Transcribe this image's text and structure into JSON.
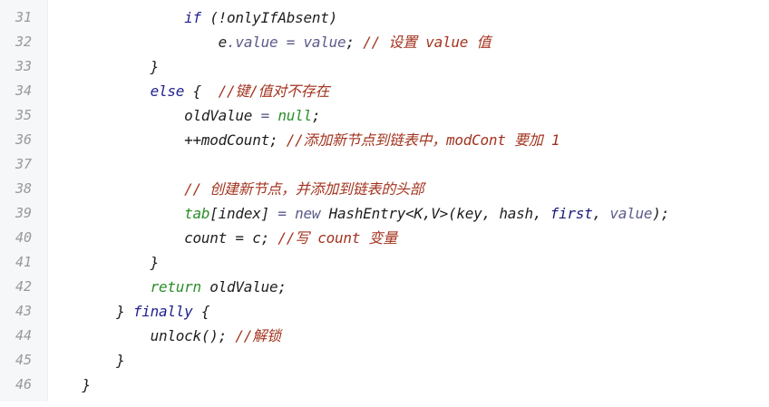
{
  "line_numbers": [
    "31",
    "32",
    "33",
    "34",
    "35",
    "36",
    "37",
    "38",
    "39",
    "40",
    "41",
    "42",
    "43",
    "44",
    "45",
    "46"
  ],
  "lines": {
    "l31": {
      "indent": "                ",
      "kw_if": "if",
      "rest": " (!onlyIfAbsent)"
    },
    "l32": {
      "indent": "                    ",
      "e": "e",
      "dot_value": ".value",
      "eq": " = ",
      "value": "value",
      "semi": "; ",
      "comment": "// 设置 value 值"
    },
    "l33": {
      "indent": "            ",
      "brace": "}"
    },
    "l34": {
      "indent": "            ",
      "kw_else": "else",
      "brace": " {  ",
      "comment": "//键/值对不存在"
    },
    "l35": {
      "indent": "                ",
      "var": "oldValue",
      "eq": " = ",
      "null": "null",
      "semi": ";"
    },
    "l36": {
      "indent": "                ",
      "code": "++modCount; ",
      "comment": "//添加新节点到链表中，modCont 要加 1"
    },
    "l37": {
      "text": ""
    },
    "l38": {
      "indent": "                ",
      "comment": "// 创建新节点，并添加到链表的头部"
    },
    "l39": {
      "indent": "                ",
      "tab": "tab",
      "index": "[index]",
      "eq": " = ",
      "kw_new": "new",
      "type": " HashEntry<K,V>",
      "args_open": "(key, hash, ",
      "first": "first",
      "comma": ", ",
      "value": "value",
      "args_close": ");"
    },
    "l40": {
      "indent": "                ",
      "code": "count = c; ",
      "comment": "//写 count 变量"
    },
    "l41": {
      "indent": "            ",
      "brace": "}"
    },
    "l42": {
      "indent": "            ",
      "kw_return": "return",
      "rest": " oldValue;"
    },
    "l43": {
      "indent": "        ",
      "brace": "} ",
      "kw_finally": "finally",
      "rest": " {"
    },
    "l44": {
      "indent": "            ",
      "code": "unlock(); ",
      "comment": "//解锁"
    },
    "l45": {
      "indent": "        ",
      "brace": "}"
    },
    "l46": {
      "indent": "    ",
      "brace": "}"
    }
  }
}
